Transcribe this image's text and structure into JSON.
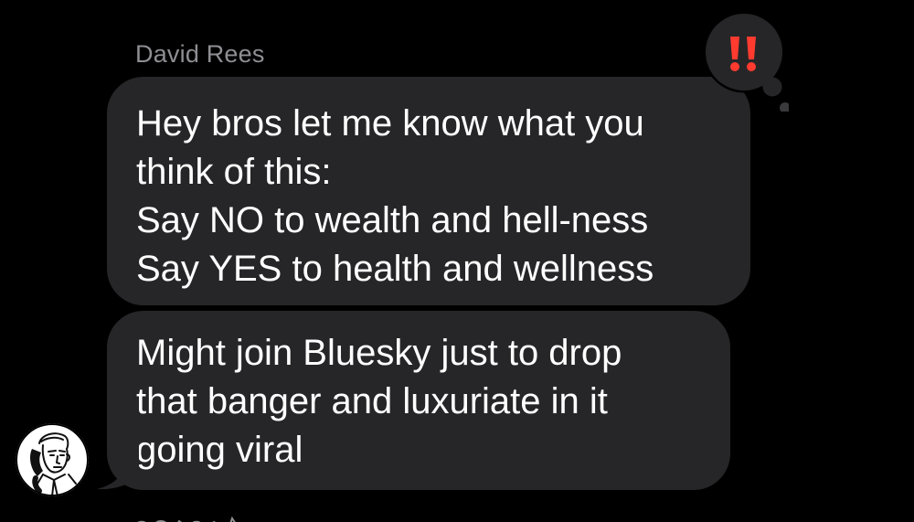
{
  "conversation": {
    "sender_name": "David Rees",
    "messages": [
      {
        "text": "Hey bros let me know what you\nthink of this:\nSay NO to wealth and hell-ness\nSay YES to health and wellness",
        "reaction": "double-exclamation-icon"
      },
      {
        "text": "Might join Bluesky just to drop\nthat banger and luxuriate in it\ngoing viral"
      }
    ]
  },
  "colors": {
    "background": "#000000",
    "bubble": "#262628",
    "sender_name": "#8e8e93",
    "reaction_red": "#ff3b30"
  }
}
